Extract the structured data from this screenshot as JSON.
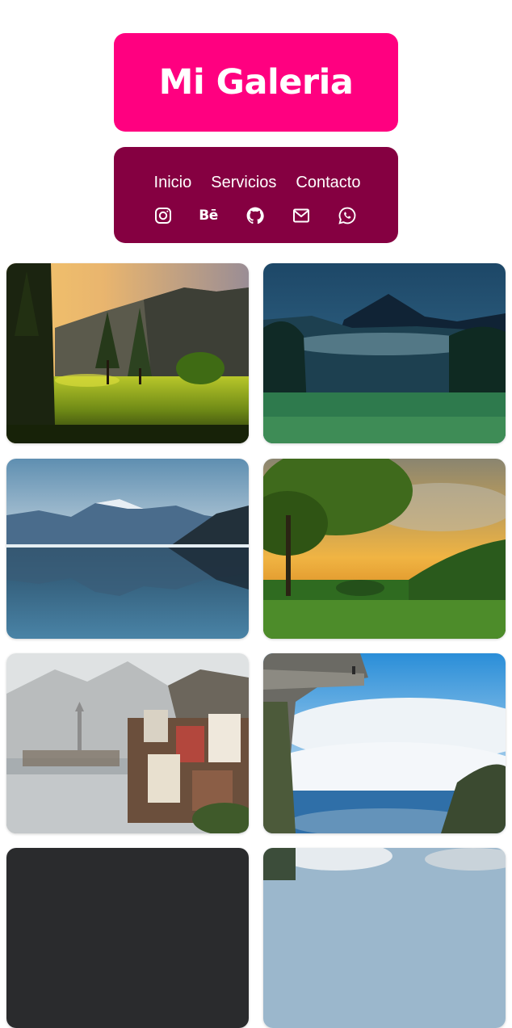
{
  "header": {
    "title": "Mi Galeria"
  },
  "nav": {
    "links": [
      "Inicio",
      "Servicios",
      "Contacto"
    ],
    "social_icons": [
      "instagram-icon",
      "behance-icon",
      "github-icon",
      "mail-icon",
      "whatsapp-icon"
    ],
    "behance_text": "Bē"
  },
  "gallery": {
    "photos": [
      "forest-sunset-meadow",
      "volcano-night-valley",
      "mountain-lake-reflection",
      "tree-valley-sunset",
      "lakeside-alpine-village",
      "cliff-over-clouds",
      "dark-photo",
      "cloudy-mountain-photo"
    ]
  },
  "colors": {
    "header_bg": "#ff0080",
    "nav_bg": "#850041",
    "text": "#ffffff"
  }
}
